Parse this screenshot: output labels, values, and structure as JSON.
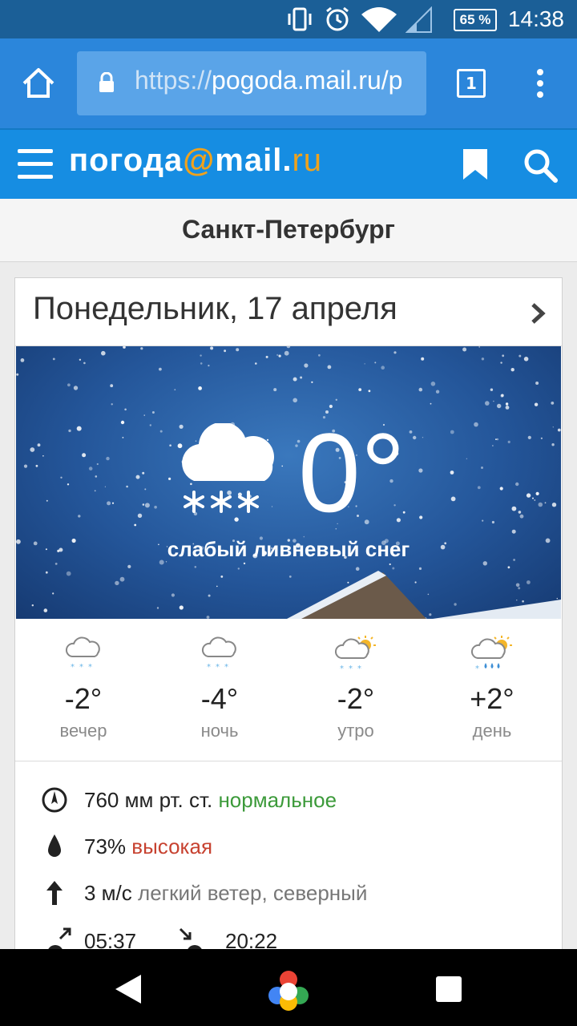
{
  "status_bar": {
    "battery": "65 %",
    "time": "14:38"
  },
  "browser": {
    "url_scheme": "https://",
    "url_rest": "pogoda.mail.ru/p",
    "tab_count": "1"
  },
  "site": {
    "logo_text": "погода",
    "logo_at": "@",
    "logo_mail": "mail.",
    "logo_ru": "ru"
  },
  "city": "Санкт-Петербург",
  "forecast": {
    "date": "Понедельник, 17 апреля",
    "current_temp": "0°",
    "condition": "слабый ливневый снег"
  },
  "periods": [
    {
      "temp": "-2°",
      "label": "вечер",
      "icon": "cloud-snow-icon"
    },
    {
      "temp": "-4°",
      "label": "ночь",
      "icon": "cloud-snow-icon"
    },
    {
      "temp": "-2°",
      "label": "утро",
      "icon": "sun-cloud-snow-icon"
    },
    {
      "temp": "+2°",
      "label": "день",
      "icon": "sun-cloud-rain-snow-icon"
    }
  ],
  "details": {
    "pressure_value": "760 мм рт. ст.",
    "pressure_status": "нормальное",
    "humidity_value": "73%",
    "humidity_status": "высокая",
    "wind_value": "3 м/с",
    "wind_desc": "легкий ветер, северный",
    "sunrise": "05:37",
    "sunset": "20:22"
  },
  "colors": {
    "status_bar": "#1b5f97",
    "browser_bar": "#2b86db",
    "site_header": "#168de2",
    "logo_accent": "#f0a21c",
    "normal_green": "#3c9a3a",
    "high_red": "#c74230"
  }
}
